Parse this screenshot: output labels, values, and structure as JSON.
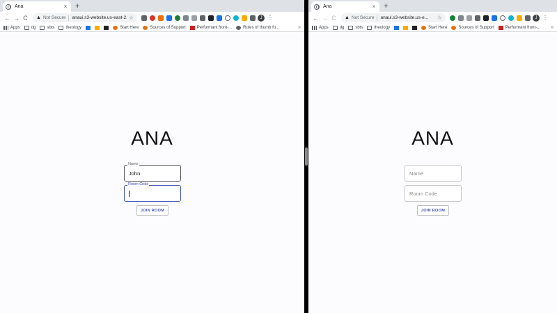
{
  "left_window": {
    "tab": {
      "title": "Ana",
      "close": "×"
    },
    "new_tab": "+",
    "nav": {
      "back": "←",
      "forward": "→",
      "reload": "C"
    },
    "omnibox": {
      "security": "Not Secure",
      "url": "anaui.s3-website.us-east-2.ama...",
      "star": "☆"
    },
    "avatar": "J",
    "menu": "⋮",
    "bookmarks": [
      "Apps",
      "dg",
      "sbts",
      "theology",
      "",
      "",
      "",
      "Start Here",
      "Sources of Support",
      "Performant front-...",
      "Rules of thumb fo..."
    ],
    "bookmarks_more": "»",
    "page": {
      "brand": "ANA",
      "name_label": "Name",
      "name_value": "John",
      "room_label": "Room Code",
      "join_button": "JOIN ROOM"
    }
  },
  "right_window": {
    "tab": {
      "title": "Ana",
      "close": "×"
    },
    "new_tab": "+",
    "nav": {
      "back": "←",
      "forward": "→",
      "reload": "C"
    },
    "omnibox": {
      "security": "Not Secure",
      "url": "anaui.s3-website.us-e...",
      "star": "☆"
    },
    "avatar": "J",
    "menu": "⋮",
    "bookmarks": [
      "Apps",
      "dg",
      "sbts",
      "theology",
      "",
      "",
      "",
      "Start Here",
      "Sources of Support",
      "Performant front-..."
    ],
    "bookmarks_more": "»",
    "page": {
      "brand": "ANA",
      "name_placeholder": "Name",
      "room_placeholder": "Room Code",
      "join_button": "JOIN ROOM"
    }
  },
  "colors": {
    "accent": "#3f51b5",
    "page_background": "#fcfbfe",
    "tab_strip": "#dee1e6"
  }
}
